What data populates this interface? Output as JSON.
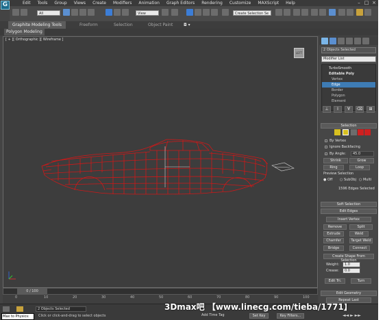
{
  "menu": {
    "items": [
      "Edit",
      "Tools",
      "Group",
      "Views",
      "Create",
      "Modifiers",
      "Animation",
      "Graph Editors",
      "Rendering",
      "Customize",
      "MAXScript",
      "Help"
    ]
  },
  "toolbar": {
    "filter_value": "All",
    "view_value": "View",
    "selection_set_value": "Create Selection Se"
  },
  "ribbon": {
    "tabs": [
      "Graphite Modeling Tools",
      "Freeform",
      "Selection",
      "Object Paint"
    ],
    "sub_tab": "Polygon Modeling"
  },
  "viewport": {
    "label": "[ + ][ Orthographic ][ Wireframe ]",
    "viewcube_label": "LEFT",
    "object_color": "#d01818",
    "axis_colors": {
      "x": "#c83232",
      "y": "#32c832",
      "z": "#3264c8"
    }
  },
  "timeline": {
    "slider_text": "0 / 100",
    "ticks": [
      "0",
      "10",
      "20",
      "30",
      "40",
      "50",
      "60",
      "70",
      "80",
      "90",
      "100"
    ]
  },
  "status": {
    "selected": "2 Objects Selected",
    "prompt": "Click or click-and-drag to select objects",
    "maxscript": "Max to Physics: ",
    "add_time_tag": "Add Time Tag",
    "set_key": "Set Key",
    "key_filters": "Key Filters..."
  },
  "watermark": "3Dmax吧 【www.linecg.com/tieba/1771】",
  "command_panel": {
    "selected_name": "2 Objects Selected",
    "modifier_list": "Modifier List",
    "stack": [
      {
        "label": "TurboSmooth",
        "level": 0
      },
      {
        "label": "Editable Poly",
        "level": 0
      },
      {
        "label": "Vertex",
        "level": 1
      },
      {
        "label": "Edge",
        "level": 1,
        "selected": true
      },
      {
        "label": "Border",
        "level": 1
      },
      {
        "label": "Polygon",
        "level": 1
      },
      {
        "label": "Element",
        "level": 1
      }
    ],
    "selection": {
      "title": "Selection",
      "by_vertex": "By Vertex",
      "ignore_backfacing": "Ignore Backfacing",
      "by_angle": "By Angle:",
      "angle_value": "45.0",
      "shrink": "Shrink",
      "grow": "Grow",
      "ring": "Ring",
      "loop": "Loop",
      "preview_title": "Preview Selection",
      "preview_options": [
        "Off",
        "SubObj",
        "Multi"
      ],
      "count_text": "1596 Edges Selected"
    },
    "soft_selection": "Soft Selection",
    "edit_edges": {
      "title": "Edit Edges",
      "insert_vertex": "Insert Vertex",
      "remove": "Remove",
      "split": "Split",
      "extrude": "Extrude",
      "weld": "Weld",
      "chamfer": "Chamfer",
      "target_weld": "Target Weld",
      "bridge": "Bridge",
      "connect": "Connect",
      "create_shape": "Create Shape From Selection",
      "weight_label": "Weight:",
      "weight_value": "1.0",
      "crease_label": "Crease:",
      "crease_value": "0.0",
      "edit_tri": "Edit Tri.",
      "turn": "Turn"
    },
    "edit_geometry": {
      "title": "Edit Geometry",
      "repeat_last": "Repeat Last"
    }
  }
}
